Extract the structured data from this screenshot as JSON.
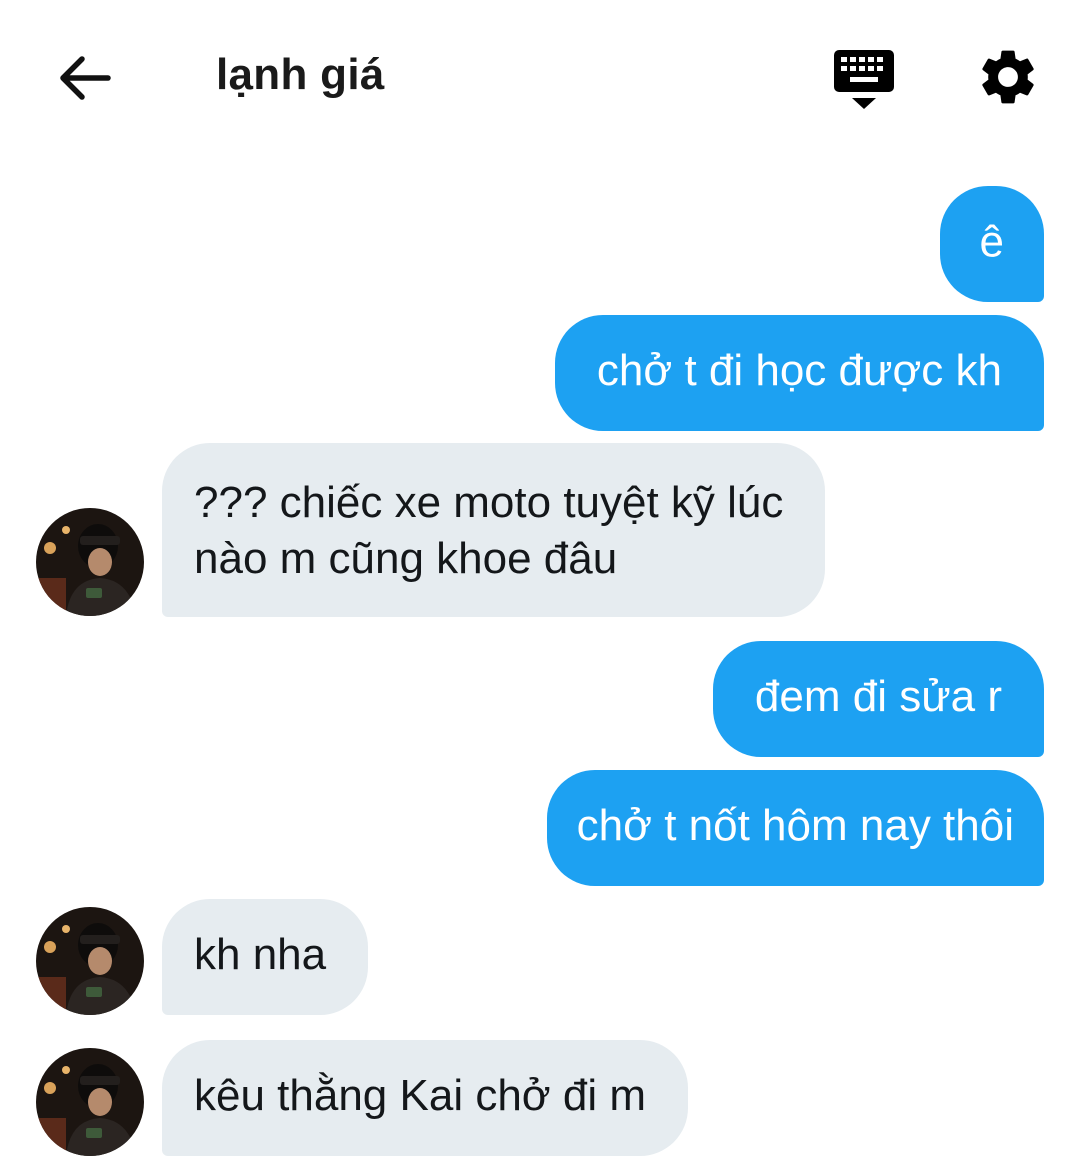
{
  "header": {
    "title": "lạnh giá",
    "back_icon": "arrow-left-icon",
    "keyboard_icon": "keyboard-icon",
    "settings_icon": "gear-icon"
  },
  "colors": {
    "outgoing_bubble": "#1da1f2",
    "incoming_bubble": "#e6ecf0",
    "outgoing_text": "#ffffff",
    "incoming_text": "#14171a"
  },
  "messages": [
    {
      "direction": "out",
      "text": "ê"
    },
    {
      "direction": "out",
      "text": "chở t đi học được kh"
    },
    {
      "direction": "in",
      "lines": [
        "??? chiếc xe moto tuyệt kỹ lúc",
        "nào m cũng khoe đâu"
      ]
    },
    {
      "direction": "out",
      "text": "đem đi sửa r"
    },
    {
      "direction": "out",
      "text": "chở t nốt hôm nay thôi"
    },
    {
      "direction": "in",
      "text": "kh nha"
    },
    {
      "direction": "in",
      "text": "kêu thằng Kai chở đi m"
    }
  ]
}
